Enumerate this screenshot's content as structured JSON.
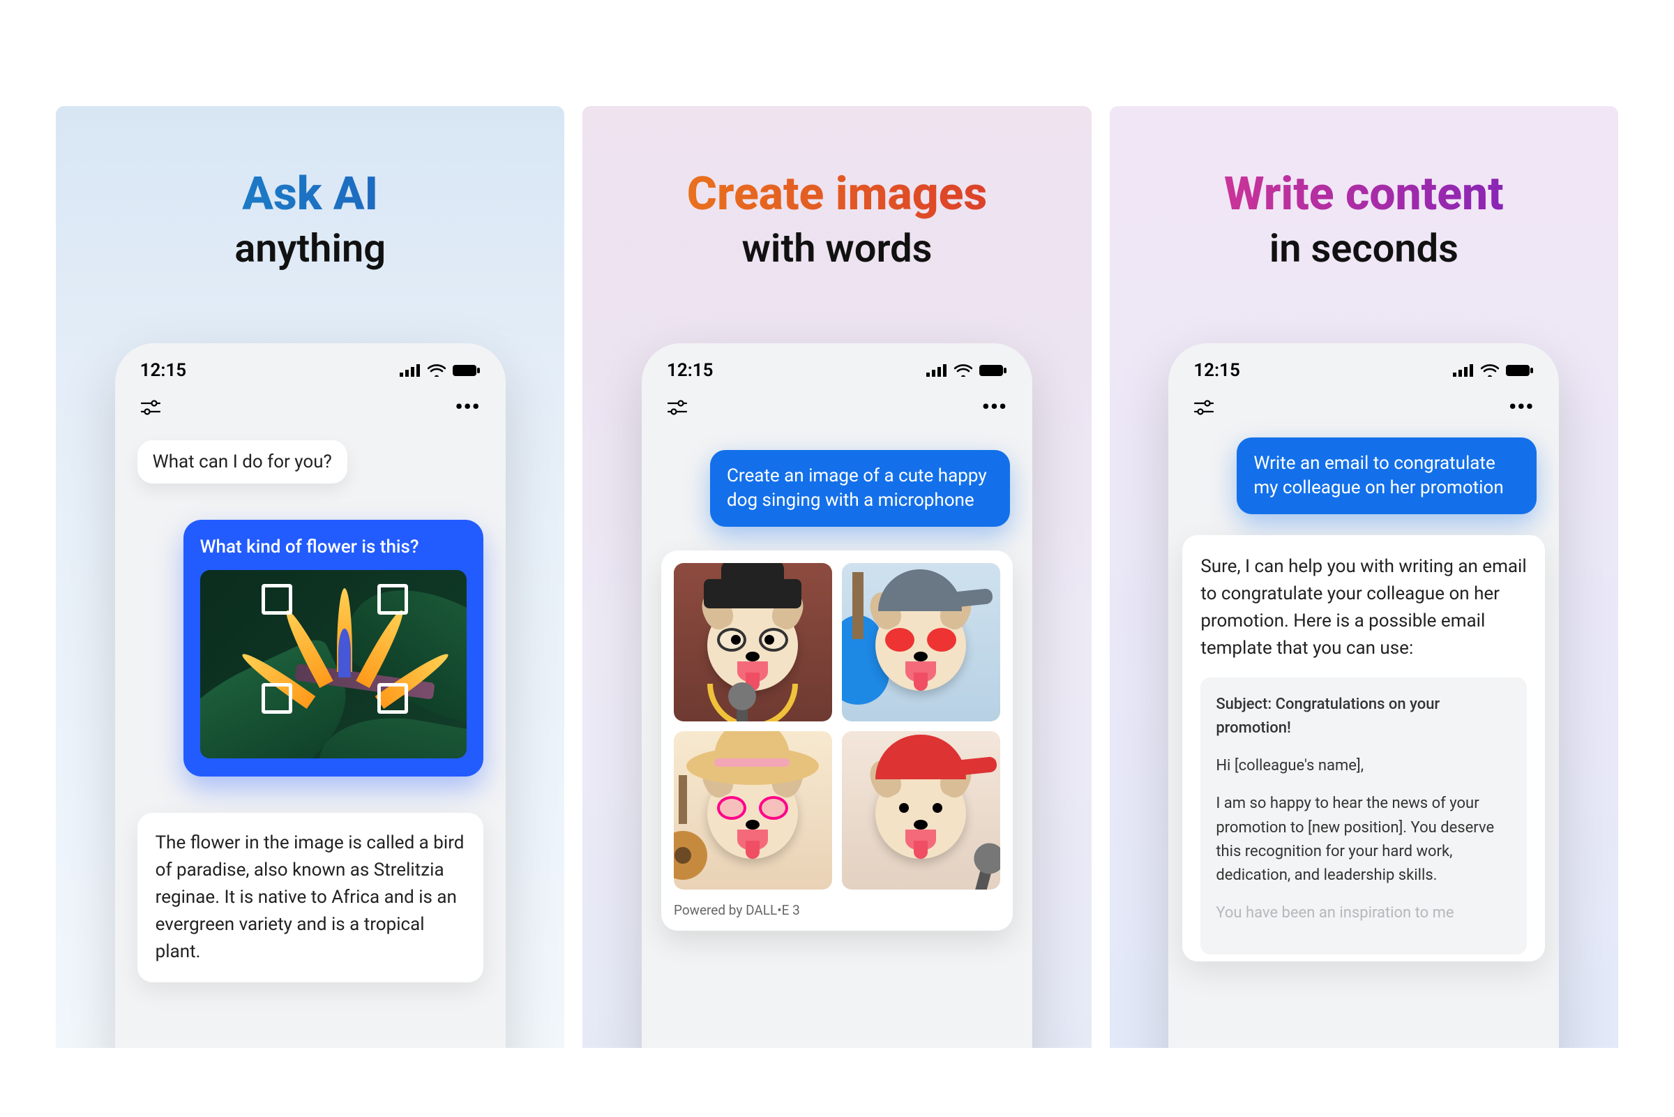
{
  "status": {
    "time": "12:15"
  },
  "panel1": {
    "title_line1": "Ask AI",
    "title_line2": "anything",
    "greeting": "What can I do for you?",
    "user_question": "What kind of flower is this?",
    "answer": "The flower in the image is called a bird of paradise, also known as Strelitzia reginae. It is native to Africa and is an evergreen variety and is a tropical plant."
  },
  "panel2": {
    "title_line1": "Create images",
    "title_line2": "with words",
    "user_prompt": "Create an image of a cute happy dog singing with a microphone",
    "image_caption": "Powered by DALL•E 3"
  },
  "panel3": {
    "title_line1": "Write content",
    "title_line2": "in seconds",
    "user_prompt": "Write an email to congratulate my colleague on her promotion",
    "reply_intro": "Sure, I can help you with writing an email to congratulate your colleague on her promotion. Here is a possible email template that you can use:",
    "email_subject": "Subject: Congratulations on your promotion!",
    "email_greeting": "Hi [colleague's name],",
    "email_body1": "I am so happy to hear the news of your promotion to [new position]. You deserve this recognition for your hard work, dedication, and leadership skills.",
    "email_body2": "You have been an inspiration to me"
  }
}
